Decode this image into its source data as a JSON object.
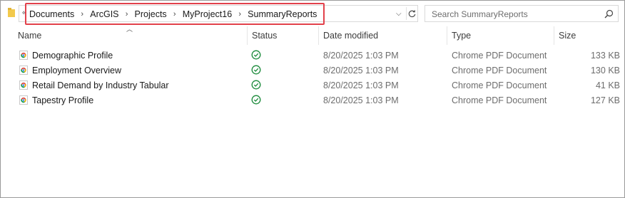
{
  "address_bar": {
    "overflow_chevron": "«",
    "crumbs": [
      "Documents",
      "ArcGIS",
      "Projects",
      "MyProject16",
      "SummaryReports"
    ],
    "separator": "›"
  },
  "search": {
    "placeholder": "Search SummaryReports"
  },
  "columns": {
    "name": "Name",
    "status": "Status",
    "date_modified": "Date modified",
    "type": "Type",
    "size": "Size"
  },
  "files": [
    {
      "name": "Demographic Profile",
      "date": "8/20/2025 1:03 PM",
      "type": "Chrome PDF Document",
      "size": "133 KB",
      "status": "synced"
    },
    {
      "name": "Employment Overview",
      "date": "8/20/2025 1:03 PM",
      "type": "Chrome PDF Document",
      "size": "130 KB",
      "status": "synced"
    },
    {
      "name": "Retail Demand by Industry Tabular",
      "date": "8/20/2025 1:03 PM",
      "type": "Chrome PDF Document",
      "size": "41 KB",
      "status": "synced"
    },
    {
      "name": "Tapestry Profile",
      "date": "8/20/2025 1:03 PM",
      "type": "Chrome PDF Document",
      "size": "127 KB",
      "status": "synced"
    }
  ],
  "colors": {
    "highlight": "#e2414b",
    "status_ok": "#1a8a3a",
    "folder": "#f2c94c"
  },
  "icons": {
    "folder": "folder-icon",
    "file": "chrome-pdf-icon",
    "status": "check-circle-icon",
    "search": "search-icon",
    "refresh": "refresh-icon"
  }
}
